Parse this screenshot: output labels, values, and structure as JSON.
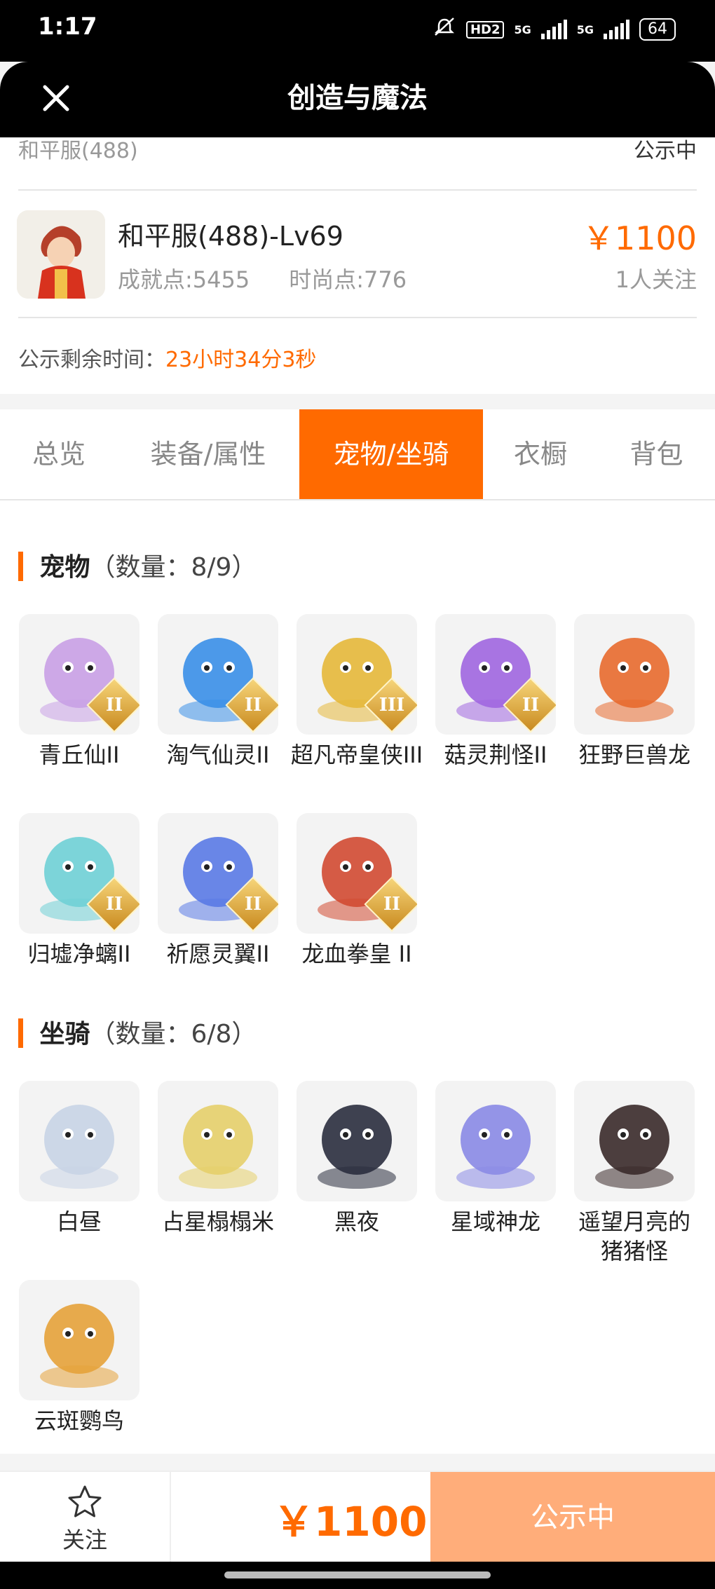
{
  "status_bar": {
    "time": "1:17",
    "hd_label": "HD2",
    "net1": "5G",
    "net2": "5G",
    "battery": "64"
  },
  "header": {
    "title": "创造与魔法"
  },
  "listing": {
    "server_cut": "和平服(488)",
    "status_cut": "公示中",
    "char_name": "和平服(488)-Lv69",
    "achievement": "成就点:5455",
    "fashion": "时尚点:776",
    "price": "￥1100",
    "followers": "1人关注",
    "timer_label": "公示剩余时间：",
    "timer_value": "23小时34分3秒"
  },
  "tabs": [
    {
      "label": "总览",
      "active": false
    },
    {
      "label": "装备/属性",
      "active": false
    },
    {
      "label": "宠物/坐骑",
      "active": true
    },
    {
      "label": "衣橱",
      "active": false
    },
    {
      "label": "背包",
      "active": false
    }
  ],
  "pets": {
    "title": "宠物",
    "count": "（数量：8/9）",
    "items": [
      {
        "name": "青丘仙II",
        "badge": "II",
        "color": "#c9a0e6"
      },
      {
        "name": "淘气仙灵II",
        "badge": "II",
        "color": "#3a8fe8"
      },
      {
        "name": "超凡帝皇侠III",
        "badge": "III",
        "color": "#e6b83a"
      },
      {
        "name": "菇灵荆怪II",
        "badge": "II",
        "color": "#a066e0"
      },
      {
        "name": "狂野巨兽龙",
        "badge": "",
        "color": "#e86a2e"
      },
      {
        "name": "归墟净螭II",
        "badge": "II",
        "color": "#6fd0d6"
      },
      {
        "name": "祈愿灵翼II",
        "badge": "II",
        "color": "#5a7ae6"
      },
      {
        "name": "龙血拳皇 II",
        "badge": "II",
        "color": "#d24a32"
      }
    ]
  },
  "mounts": {
    "title": "坐骑",
    "count": "（数量：6/8）",
    "items": [
      {
        "name": "白昼",
        "color": "#c8d4e6"
      },
      {
        "name": "占星榻榻米",
        "color": "#e6cf6a"
      },
      {
        "name": "黑夜",
        "color": "#2a2e3e"
      },
      {
        "name": "星域神龙",
        "color": "#8a8ae6"
      },
      {
        "name": "遥望月亮的猪猪怪",
        "color": "#3a2a2a"
      },
      {
        "name": "云斑鹦鸟",
        "color": "#e6a23a"
      }
    ]
  },
  "bottom": {
    "follow_label": "关注",
    "price": "￥1100",
    "status_button": "公示中"
  },
  "colors": {
    "accent": "#ff6a00",
    "status_button": "#ffad7a"
  }
}
